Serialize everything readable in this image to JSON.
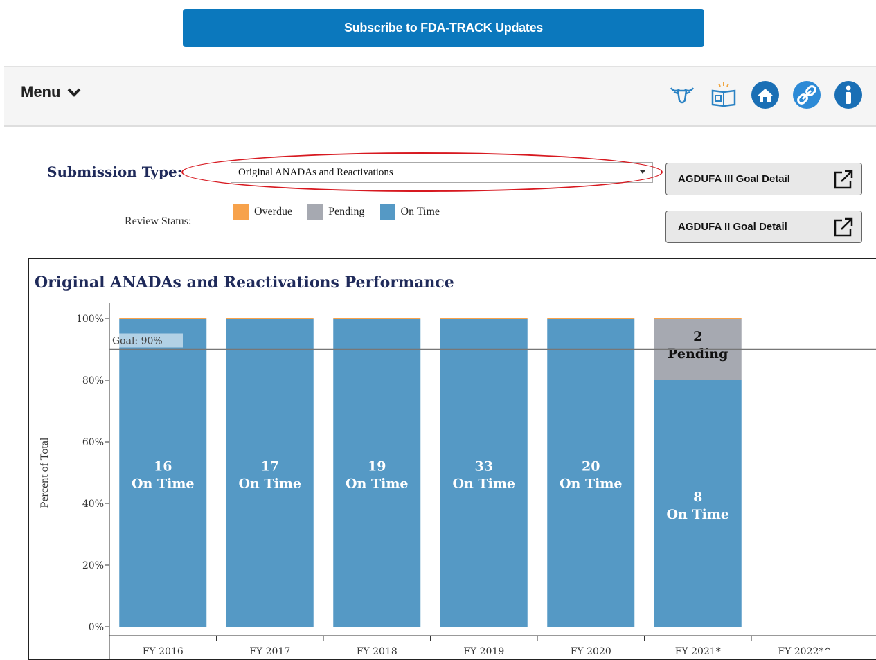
{
  "subscribe": {
    "label": "Subscribe to FDA-TRACK Updates"
  },
  "menu": {
    "label": "Menu"
  },
  "toolbar_icons": [
    "cow-icon",
    "book-icon",
    "home-icon",
    "link-icon",
    "info-icon"
  ],
  "filters": {
    "submission_type_label": "Submission Type:",
    "submission_type_value": "Original ANADAs and Reactivations",
    "review_status_label": "Review Status:",
    "legend": [
      {
        "label": "Overdue",
        "color": "#f7a24b"
      },
      {
        "label": "Pending",
        "color": "#a6a9b1"
      },
      {
        "label": "On Time",
        "color": "#5599c5"
      }
    ]
  },
  "buttons": {
    "agdufa3": "AGDUFA III Goal Detail",
    "agdufa2": "AGDUFA II Goal Detail"
  },
  "colors": {
    "brand": "#0b78bd",
    "on_time": "#5599c5",
    "pending": "#a6a9b1",
    "overdue": "#f7a24b",
    "title": "#1f2a5a"
  },
  "chart_data": {
    "type": "bar",
    "title": "Original ANADAs and Reactivations Performance",
    "ylabel": "Percent of Total",
    "ylim": [
      0,
      100
    ],
    "yticks": [
      "0%",
      "20%",
      "40%",
      "60%",
      "80%",
      "100%"
    ],
    "categories": [
      "FY 2016",
      "FY 2017",
      "FY 2018",
      "FY 2019",
      "FY 2020",
      "FY 2021*",
      "FY 2022*^"
    ],
    "goal": {
      "value": 90,
      "label": "Goal: 90%"
    },
    "series": [
      {
        "name": "On Time",
        "values": [
          100,
          100,
          100,
          100,
          100,
          80,
          0
        ],
        "counts": [
          16,
          17,
          19,
          33,
          20,
          8,
          0
        ]
      },
      {
        "name": "Pending",
        "values": [
          0,
          0,
          0,
          0,
          0,
          20,
          0
        ],
        "counts": [
          0,
          0,
          0,
          0,
          0,
          2,
          0
        ]
      },
      {
        "name": "Overdue",
        "values": [
          0,
          0,
          0,
          0,
          0,
          0,
          0
        ],
        "counts": [
          0,
          0,
          0,
          0,
          0,
          0,
          0
        ]
      }
    ]
  }
}
